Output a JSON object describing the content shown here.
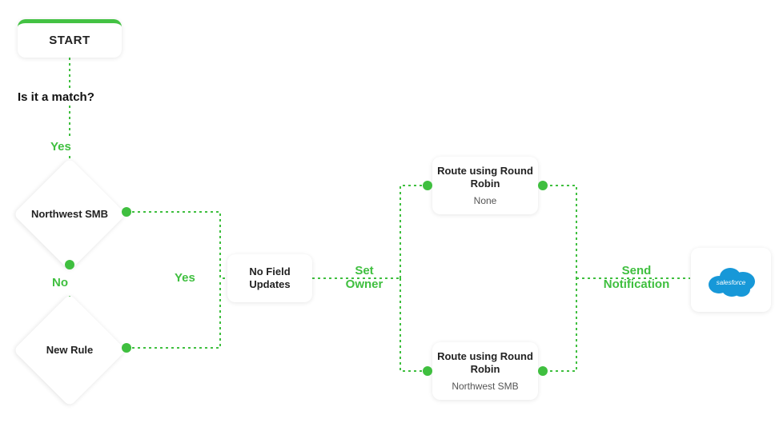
{
  "colors": {
    "accent": "#3fbf3f",
    "salesforce_blue": "#1798d8"
  },
  "start": {
    "label": "START"
  },
  "question": "Is it a match?",
  "edges": {
    "yes_top": "Yes",
    "no": "No",
    "yes_right": "Yes",
    "set_owner": "Set Owner",
    "send_notification": "Send Notification"
  },
  "decisions": {
    "d1": "Northwest SMB",
    "d2": "New Rule"
  },
  "steps": {
    "no_field_updates": "No Field Updates",
    "route_top": {
      "title": "Route using Round Robin",
      "subtitle": "None"
    },
    "route_bottom": {
      "title": "Route using Round Robin",
      "subtitle": "Northwest SMB"
    }
  },
  "endpoint": {
    "name": "salesforce",
    "icon": "salesforce-cloud-icon"
  }
}
